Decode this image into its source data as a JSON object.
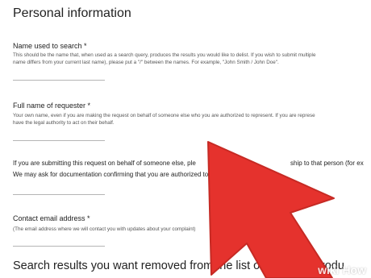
{
  "section_title": "Personal information",
  "fields": [
    {
      "label": "Name used to search *",
      "help_lines": [
        "This should be the name that, when used as a search query, produces the results you would like to delist. If you wish to submit multiple",
        "name differs from your current last name), please put a \"/\" between the names. For example, \"John Smith / John Doe\"."
      ]
    },
    {
      "label": "Full name of requester *",
      "help_lines": [
        "Your own name, even if you are making the request on behalf of someone else who you are authorized to represent. If you are represe",
        "have the legal authority to act on their behalf."
      ]
    },
    {
      "label": "Contact email address *",
      "help_lines": [
        "(The email address where we will contact you with updates about your complaint)"
      ]
    }
  ],
  "relationship_lines": [
    "If you are submitting this request on behalf of someone else, ple",
    "ship to that person (for ex",
    "We may ask for documentation confirming that you are authorized to"
  ],
  "bottom_heading": "Search results you want removed from the list of re",
  "bottom_heading_tail": "sults produ",
  "colors": {
    "arrow": "#e5322d",
    "arrow_stroke": "#c62a24"
  }
}
